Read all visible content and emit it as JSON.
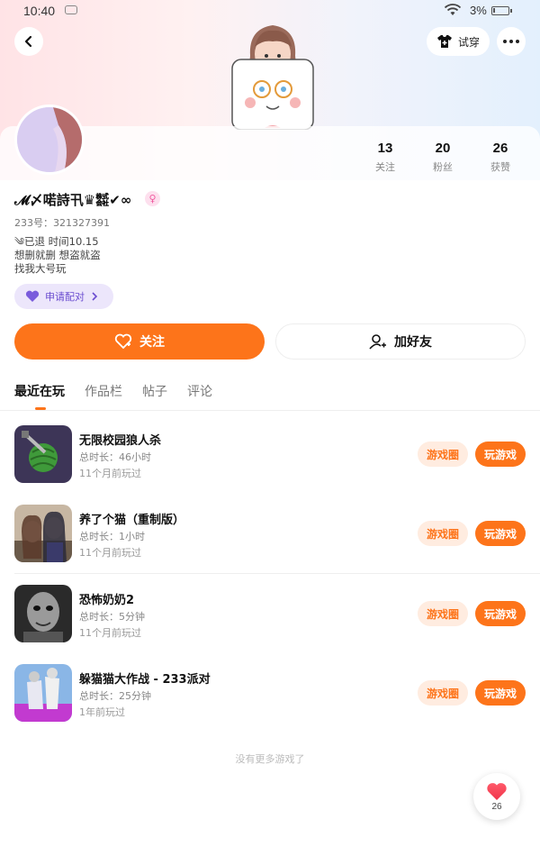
{
  "status_bar": {
    "time": "10:40",
    "battery": "3%"
  },
  "header": {
    "try_on_label": "试穿"
  },
  "profile": {
    "nickname": "𝓜〆喏詩卂♛㍿✔∞",
    "uid_label": "233号：321327391",
    "bio_lines": [
      "༄已退 时间10.15",
      "想删就删 想盗就盗",
      "找我大号玩"
    ],
    "pair_label": "申请配对",
    "stats": [
      {
        "num": "13",
        "label": "关注"
      },
      {
        "num": "20",
        "label": "粉丝"
      },
      {
        "num": "26",
        "label": "获赞"
      }
    ],
    "follow_label": "关注",
    "add_friend_label": "加好友"
  },
  "tabs": [
    "最近在玩",
    "作品栏",
    "帖子",
    "评论"
  ],
  "games": [
    {
      "title": "无限校园狼人杀",
      "duration": "总时长：46小时",
      "last": "11个月前玩过"
    },
    {
      "title": "养了个猫（重制版）",
      "duration": "总时长：1小时",
      "last": "11个月前玩过"
    },
    {
      "title": "恐怖奶奶2",
      "duration": "总时长：5分钟",
      "last": "11个月前玩过"
    },
    {
      "title": "躲猫猫大作战 - 233派对",
      "duration": "总时长：25分钟",
      "last": "1年前玩过"
    }
  ],
  "game_buttons": {
    "circle": "游戏圈",
    "play": "玩游戏"
  },
  "end_text": "没有更多游戏了",
  "like_count": "26",
  "colors": {
    "accent": "#fd741a",
    "accent_light": "#ffece0",
    "pair_purple": "#6a4cd0"
  }
}
